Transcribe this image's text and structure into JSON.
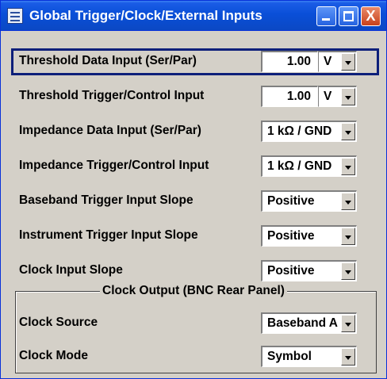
{
  "window": {
    "title": "Global Trigger/Clock/External Inputs",
    "icons": {
      "app": "settings-window-icon",
      "minimize": "minimize-icon",
      "maximize": "maximize-icon",
      "close": "close-icon"
    },
    "close_glyph": "X"
  },
  "rows": [
    {
      "label": "Threshold Data Input (Ser/Par)",
      "value": "1.00",
      "unit": "V",
      "focused": true
    },
    {
      "label": "Threshold Trigger/Control Input",
      "value": "1.00",
      "unit": "V"
    },
    {
      "label": "Impedance Data Input (Ser/Par)",
      "value": "1 kΩ / GND"
    },
    {
      "label": "Impedance Trigger/Control Input",
      "value": "1 kΩ / GND"
    },
    {
      "label": "Baseband Trigger Input Slope",
      "value": "Positive"
    },
    {
      "label": "Instrument Trigger Input Slope",
      "value": "Positive"
    },
    {
      "label": "Clock Input Slope",
      "value": "Positive"
    }
  ],
  "clock_output": {
    "title": "Clock Output (BNC Rear Panel)",
    "rows": [
      {
        "label": "Clock Source",
        "value": "Baseband A"
      },
      {
        "label": "Clock Mode",
        "value": "Symbol"
      }
    ]
  },
  "colors": {
    "titlebar": "#0a4fd8",
    "panel": "#d4d0c8",
    "focus_border": "#0d1f7a"
  }
}
